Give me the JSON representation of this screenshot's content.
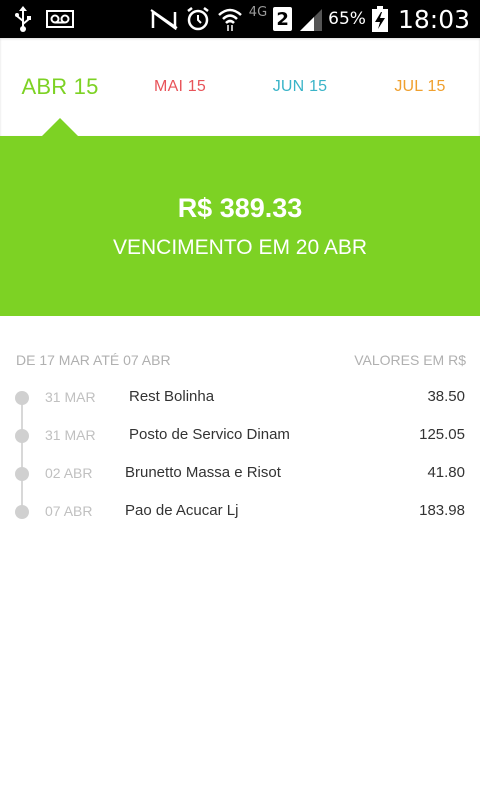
{
  "status_bar": {
    "left_icons": [
      "usb-icon",
      "voicemail-icon"
    ],
    "right_icons": [
      "nfc-icon",
      "alarm-icon",
      "wifi-icon",
      "signal-icon",
      "battery-charging-icon"
    ],
    "network": "4G",
    "sim": "2",
    "battery": "65%",
    "clock": "18:03"
  },
  "tabs": [
    {
      "label": "ABR 15",
      "color": "#7dd224",
      "active": true
    },
    {
      "label": "MAI 15",
      "color": "#e8545a",
      "active": false
    },
    {
      "label": "JUN 15",
      "color": "#3ab4c8",
      "active": false
    },
    {
      "label": "JUL 15",
      "color": "#f0a02e",
      "active": false
    }
  ],
  "summary": {
    "amount": "R$ 389.33",
    "due": "VENCIMENTO EM 20 ABR",
    "color": "#7dd224"
  },
  "transactions": {
    "period": "DE 17 MAR ATÉ 07 ABR",
    "currency_note": "VALORES EM R$",
    "items": [
      {
        "date": "31 MAR",
        "merchant": "Rest Bolinha",
        "amount": "38.50"
      },
      {
        "date": "31 MAR",
        "merchant": "Posto de Servico Dinam",
        "amount": "125.05"
      },
      {
        "date": "02 ABR",
        "merchant": "Brunetto Massa e Risot",
        "amount": "41.80"
      },
      {
        "date": "07 ABR",
        "merchant": "Pao de Acucar Lj",
        "amount": "183.98"
      }
    ]
  }
}
